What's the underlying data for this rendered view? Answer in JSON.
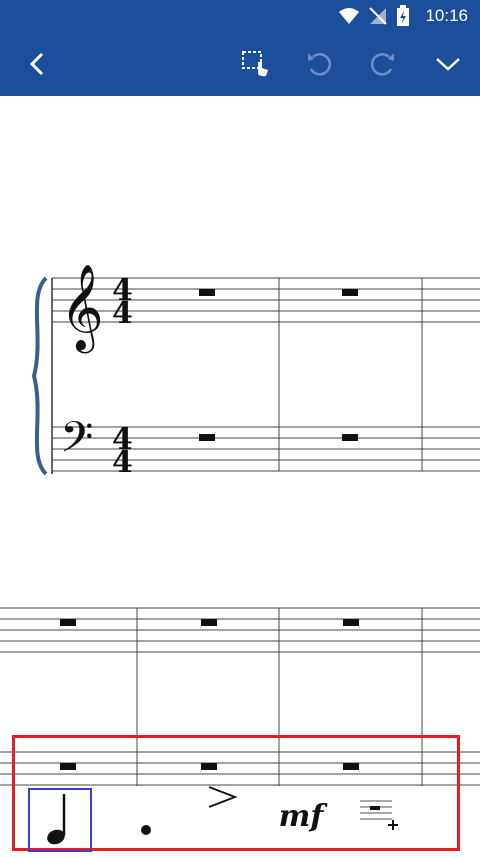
{
  "status": {
    "time": "10:16"
  },
  "toolbar": {
    "back_icon": "chevron-left-icon",
    "select_icon": "selection-touch-icon",
    "undo_icon": "undo-icon",
    "redo_icon": "redo-icon",
    "collapse_icon": "chevron-down-icon"
  },
  "palette": {
    "items": [
      {
        "name": "quarter-note",
        "icon": "quarter-note-icon",
        "selected": true
      },
      {
        "name": "dot",
        "icon": "augmentation-dot-icon",
        "selected": false
      },
      {
        "name": "accent",
        "icon": "accent-icon",
        "selected": false
      },
      {
        "name": "dynamic-mf",
        "label": "mf",
        "selected": false
      },
      {
        "name": "add-staff",
        "icon": "staff-add-icon",
        "selected": false
      }
    ]
  },
  "score": {
    "treble_time_signature": {
      "top": "4",
      "bottom": "4"
    },
    "bass_time_signature": {
      "top": "4",
      "bottom": "4"
    }
  }
}
